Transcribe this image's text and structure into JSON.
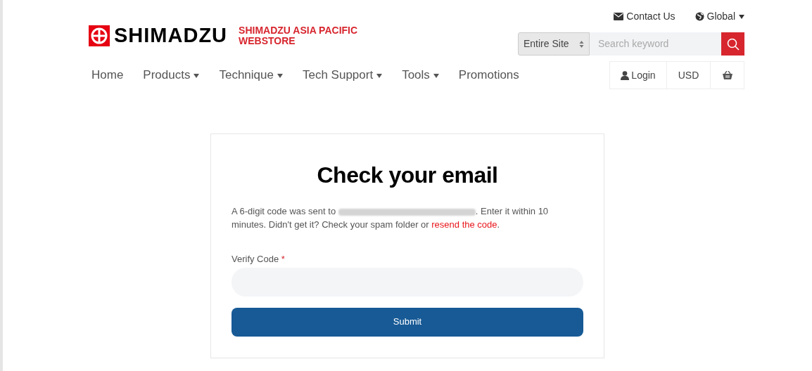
{
  "logo": {
    "brand": "SHIMADZU",
    "store_name": "SHIMADZU ASIA PACIFIC WEBSTORE"
  },
  "top_links": [
    {
      "kind": "contact",
      "label": "Contact Us",
      "has_dropdown": false
    },
    {
      "kind": "region",
      "label": "Global",
      "has_dropdown": true
    }
  ],
  "search": {
    "scope": "Entire Site",
    "placeholder": "Search keyword"
  },
  "nav": [
    {
      "label": "Home",
      "has_dropdown": false
    },
    {
      "label": "Products",
      "has_dropdown": true
    },
    {
      "label": "Technique",
      "has_dropdown": true
    },
    {
      "label": "Tech Support",
      "has_dropdown": true
    },
    {
      "label": "Tools",
      "has_dropdown": true
    },
    {
      "label": "Promotions",
      "has_dropdown": false
    }
  ],
  "account": [
    {
      "kind": "login",
      "label": "Login"
    },
    {
      "kind": "currency",
      "label": "USD"
    },
    {
      "kind": "cart"
    }
  ],
  "card": {
    "title": "Check your email",
    "message_start": "A 6-digit code was sent to",
    "message_after_email": ". Enter it within 10 minutes. Didn't get it? Check your spam folder or",
    "resend_link": "resend the code",
    "message_end": ".",
    "field_label": "Verify Code",
    "required_mark": "*",
    "submit": "Submit"
  }
}
